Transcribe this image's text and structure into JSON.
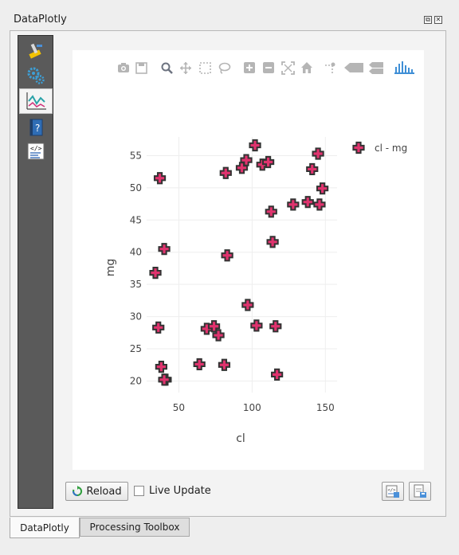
{
  "window": {
    "title": "DataPlotly"
  },
  "sidebar": {
    "items": [
      {
        "name": "plot-properties",
        "icon": "paintbrush-icon"
      },
      {
        "name": "plot-settings",
        "icon": "gears-icon"
      },
      {
        "name": "plot-view",
        "icon": "plot-icon",
        "active": true
      },
      {
        "name": "help",
        "icon": "help-icon"
      },
      {
        "name": "debug",
        "icon": "code-icon"
      }
    ]
  },
  "toolbar": {
    "icons": [
      "camera-icon",
      "save-icon",
      "zoom-icon",
      "pan-icon",
      "box-select-icon",
      "lasso-icon",
      "zoom-in-icon",
      "zoom-out-icon",
      "autoscale-icon",
      "home-icon",
      "spike-lines-icon",
      "hover-closest-icon",
      "hover-compare-icon",
      "plotly-logo-icon"
    ]
  },
  "chart_data": {
    "type": "scatter",
    "xlabel": "cl",
    "ylabel": "mg",
    "xlim": [
      28,
      158
    ],
    "ylim": [
      18.2,
      57.9
    ],
    "x_ticks": [
      50,
      100,
      150
    ],
    "y_ticks": [
      20,
      25,
      30,
      35,
      40,
      45,
      50,
      55
    ],
    "grid": true,
    "legend_position": "top-right",
    "marker": {
      "symbol": "cross",
      "fill": "#e0336e",
      "stroke": "#333333"
    },
    "series": [
      {
        "name": "cl - mg",
        "x": [
          37,
          34,
          40,
          36,
          38,
          41,
          40,
          83,
          82,
          64,
          69,
          74,
          77,
          81,
          97,
          103,
          102,
          93,
          96,
          107,
          111,
          113,
          114,
          116,
          117,
          128,
          138,
          141,
          145,
          148,
          146
        ],
        "y": [
          51.5,
          36.8,
          40.5,
          28.3,
          22.2,
          20.2,
          20.2,
          39.5,
          52.3,
          22.6,
          28.1,
          28.5,
          27.1,
          22.5,
          31.8,
          28.6,
          56.6,
          53.1,
          54.3,
          53.6,
          54.0,
          46.3,
          41.6,
          28.5,
          21.0,
          47.4,
          47.8,
          52.9,
          55.3,
          49.9,
          47.4
        ]
      }
    ]
  },
  "controls": {
    "reload_label": "Reload",
    "live_update_label": "Live Update",
    "live_update_checked": false
  },
  "tabs": [
    {
      "label": "DataPlotly",
      "active": true
    },
    {
      "label": "Processing Toolbox",
      "active": false
    }
  ]
}
